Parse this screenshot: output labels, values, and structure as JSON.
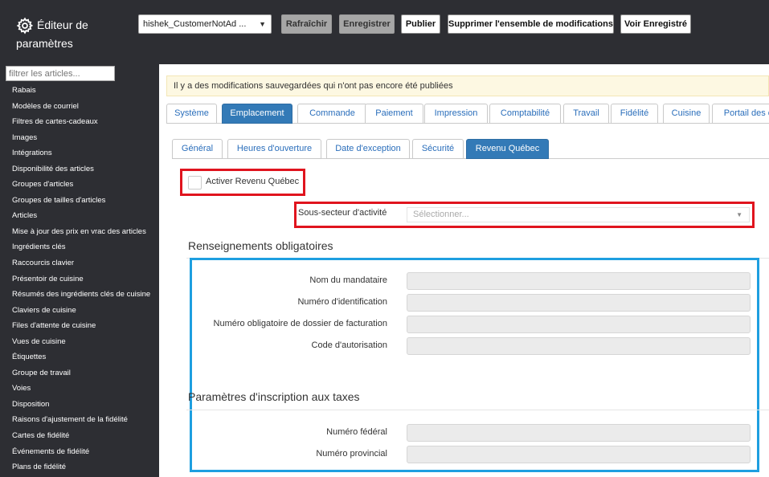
{
  "header": {
    "app_title": "Éditeur de paramètres",
    "project_select": "hishek_CustomerNotAd ...",
    "buttons": {
      "refresh": "Rafraîchir",
      "save": "Enregistrer",
      "publish": "Publier",
      "delete_changes": "Supprimer l'ensemble de modifications",
      "view_saved": "Voir Enregistré"
    }
  },
  "sidebar": {
    "filter_placeholder": "filtrer les articles...",
    "items": [
      "Rabais",
      "Modèles de courriel",
      "Filtres de cartes-cadeaux",
      "Images",
      "Intégrations",
      "Disponibilité des articles",
      "Groupes d'articles",
      "Groupes de tailles d'articles",
      "Articles",
      "Mise à jour des prix en vrac des articles",
      "Ingrédients clés",
      "Raccourcis clavier",
      "Présentoir de cuisine",
      "Résumés des ingrédients clés de cuisine",
      "Claviers de cuisine",
      "Files d'attente de cuisine",
      "Vues de cuisine",
      "Étiquettes",
      "Groupe de travail",
      "Voies",
      "Disposition",
      "Raisons d'ajustement de la fidélité",
      "Cartes de fidélité",
      "Événements de fidélité",
      "Plans de fidélité"
    ]
  },
  "notice": "Il y a des modifications sauvegardées qui n'ont pas encore été publiées",
  "main_tabs": [
    "Système",
    "Emplacement",
    "Commande",
    "Paiement",
    "Impression",
    "Comptabilité",
    "Travail",
    "Fidélité",
    "Cuisine",
    "Portail des c"
  ],
  "main_tabs_active": "Emplacement",
  "sub_tabs": [
    "Général",
    "Heures d'ouverture",
    "Date d'exception",
    "Sécurité",
    "Revenu Québec"
  ],
  "sub_tabs_active": "Revenu Québec",
  "form": {
    "enable_label": "Activer Revenu Québec",
    "enable_checked": false,
    "subsector_label": "Sous-secteur d'activité",
    "subsector_placeholder": "Sélectionner...",
    "section1_title": "Renseignements obligatoires",
    "section1_fields": [
      "Nom du mandataire",
      "Numéro d'identification",
      "Numéro obligatoire de dossier de facturation",
      "Code d'autorisation"
    ],
    "section2_title": "Paramètres d'inscription aux taxes",
    "section2_fields": [
      "Numéro fédéral",
      "Numéro provincial"
    ]
  },
  "colors": {
    "sidebar_bg": "#2d2e33",
    "tab_active": "#337ab7",
    "highlight_red": "#e0141e",
    "highlight_blue": "#1e9fe0",
    "notice_bg": "#fdf8e2"
  }
}
